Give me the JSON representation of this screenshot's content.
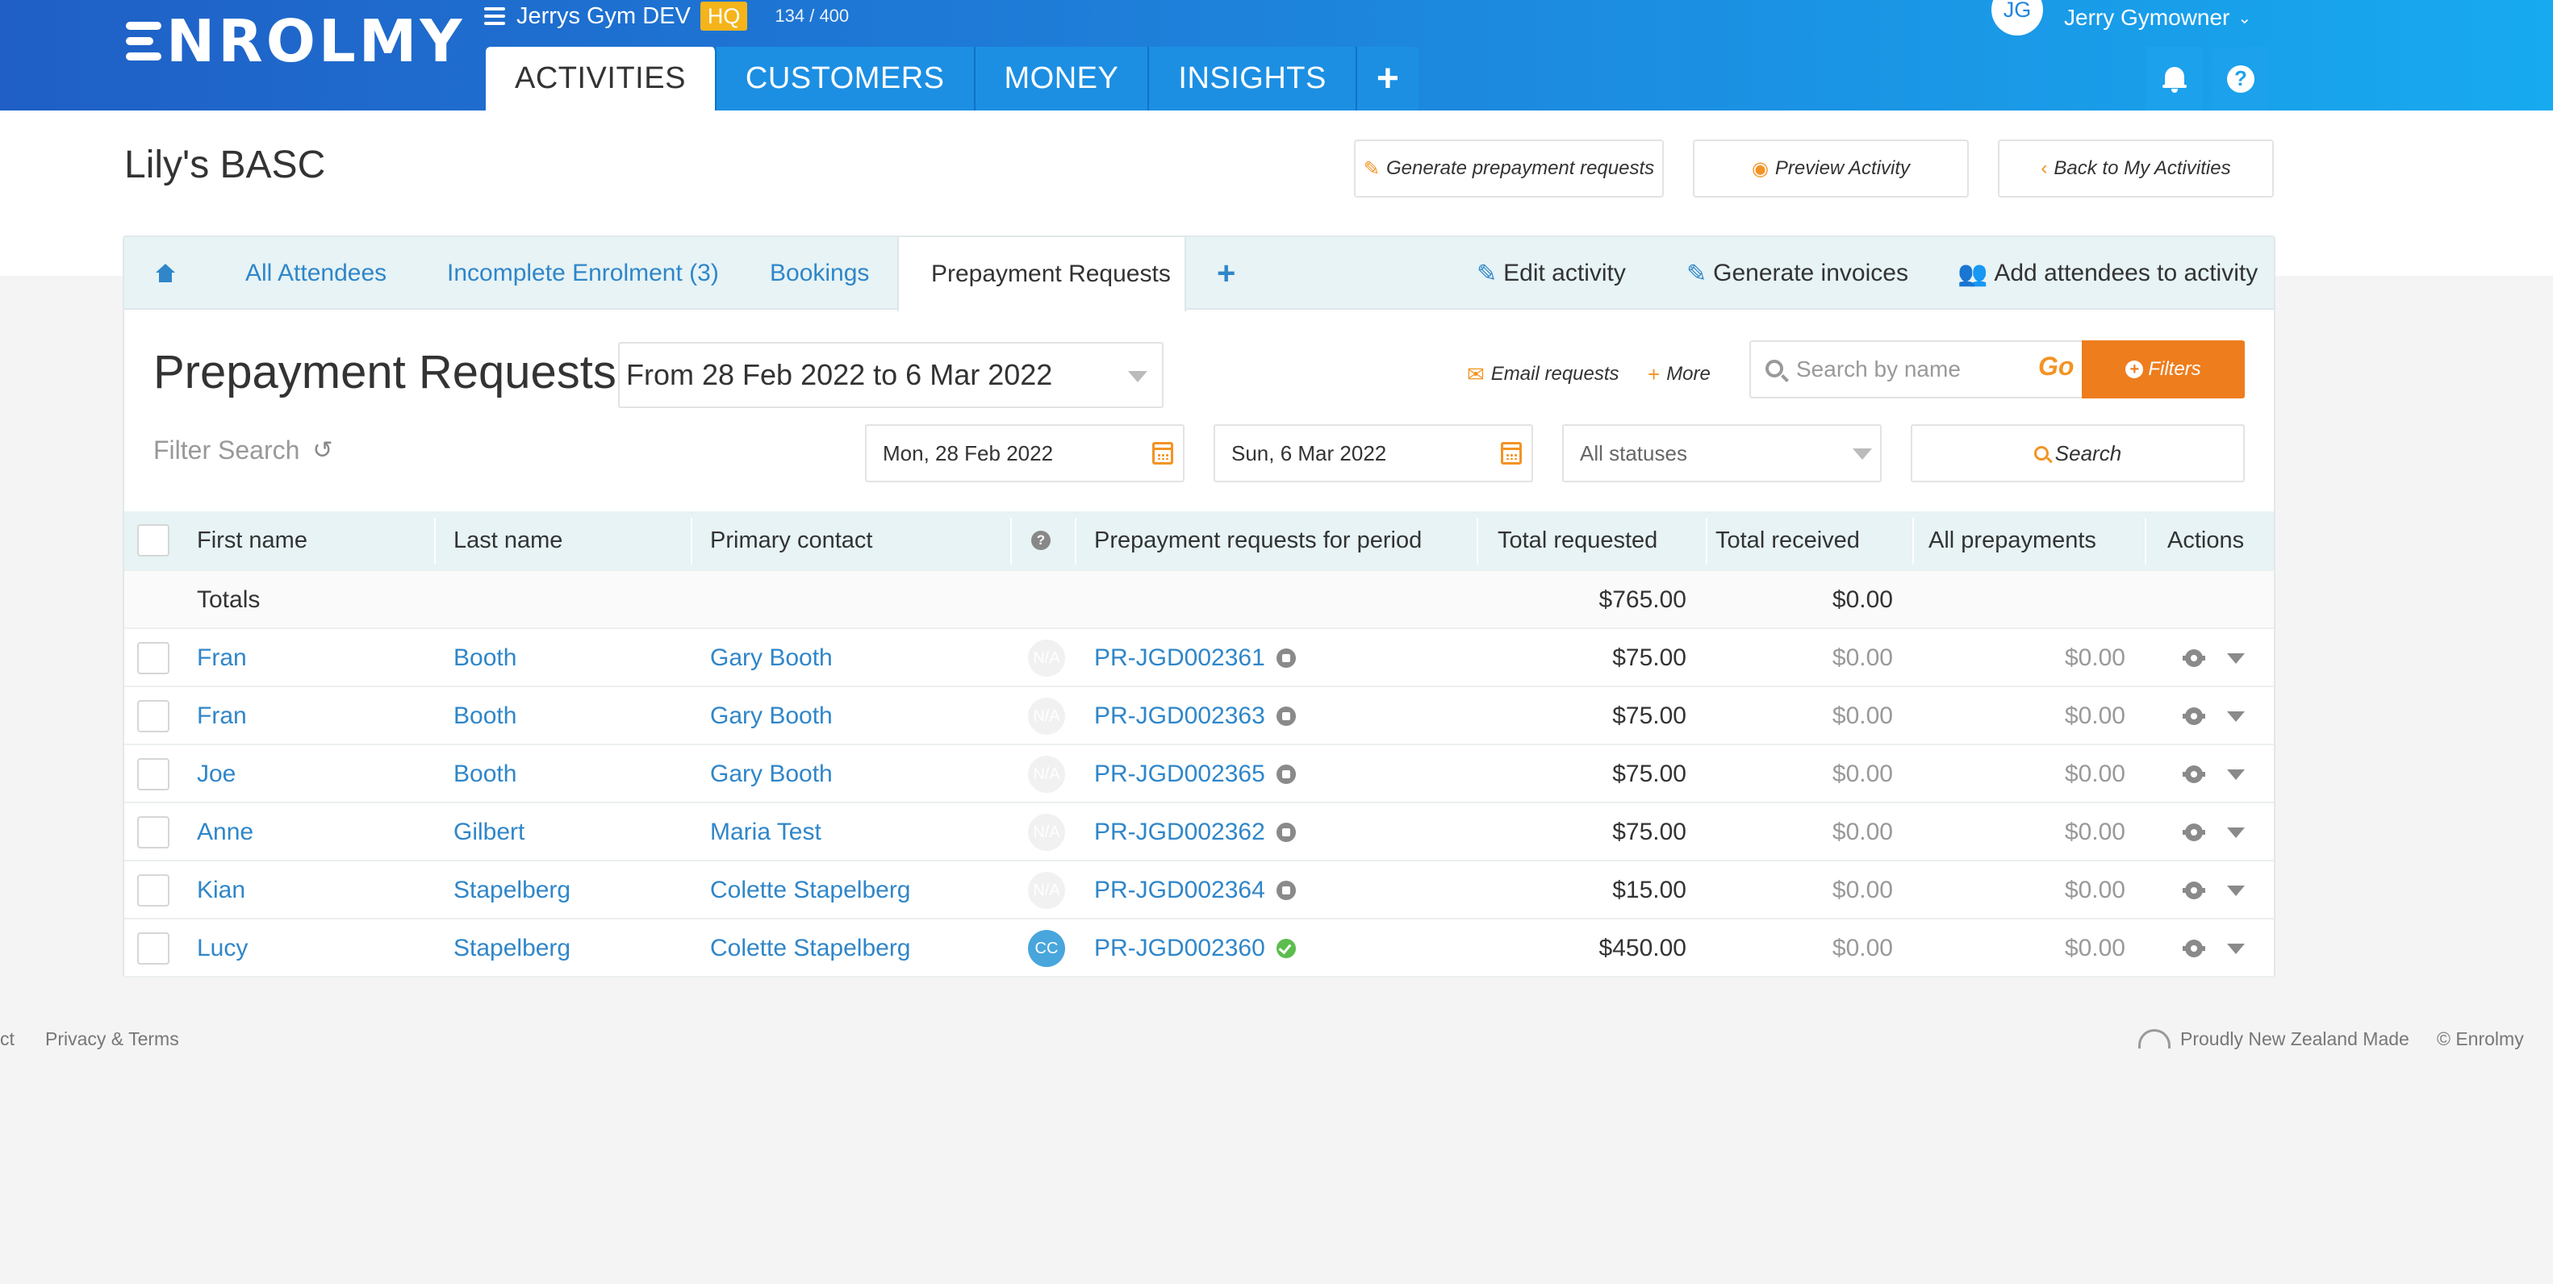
{
  "brand": {
    "logo_text": "NROLMY"
  },
  "org": {
    "name": "Jerrys Gym DEV",
    "badge": "HQ",
    "usage": "134 / 400"
  },
  "main_tabs": [
    {
      "label": "ACTIVITIES"
    },
    {
      "label": "CUSTOMERS"
    },
    {
      "label": "MONEY"
    },
    {
      "label": "INSIGHTS"
    }
  ],
  "user": {
    "initials": "JG",
    "name": "Jerry Gymowner"
  },
  "page": {
    "title": "Lily's BASC",
    "buttons": {
      "generate_prepayment": "Generate prepayment requests",
      "preview": "Preview Activity",
      "back": "Back to My Activities"
    }
  },
  "subtabs": {
    "all_attendees": "All Attendees",
    "incomplete": "Incomplete Enrolment (3)",
    "bookings": "Bookings",
    "prepayment": "Prepayment Requests",
    "edit_activity": "Edit activity",
    "generate_invoices": "Generate invoices",
    "add_attendees": "Add attendees to activity"
  },
  "section": {
    "title": "Prepayment Requests",
    "period": "From 28 Feb 2022 to 6 Mar 2022",
    "email_requests": "Email requests",
    "more": "More",
    "search_placeholder": "Search by name",
    "go": "Go",
    "filters": "Filters",
    "filter_search": "Filter Search",
    "date_from": "Mon, 28 Feb 2022",
    "date_to": "Sun, 6 Mar 2022",
    "status": "All statuses",
    "search": "Search"
  },
  "table": {
    "columns": {
      "first_name": "First name",
      "last_name": "Last name",
      "primary_contact": "Primary contact",
      "requests": "Prepayment requests for period",
      "total_requested": "Total requested",
      "total_received": "Total received",
      "all_prepayments": "All prepayments",
      "actions": "Actions"
    },
    "totals": {
      "label": "Totals",
      "requested": "$765.00",
      "received": "$0.00"
    },
    "rows": [
      {
        "first": "Fran",
        "last": "Booth",
        "contact": "Gary Booth",
        "avatar": "N/A",
        "ref": "PR-JGD002361",
        "status": "pending",
        "requested": "$75.00",
        "received": "$0.00",
        "all": "$0.00"
      },
      {
        "first": "Fran",
        "last": "Booth",
        "contact": "Gary Booth",
        "avatar": "N/A",
        "ref": "PR-JGD002363",
        "status": "pending",
        "requested": "$75.00",
        "received": "$0.00",
        "all": "$0.00"
      },
      {
        "first": "Joe",
        "last": "Booth",
        "contact": "Gary Booth",
        "avatar": "N/A",
        "ref": "PR-JGD002365",
        "status": "pending",
        "requested": "$75.00",
        "received": "$0.00",
        "all": "$0.00"
      },
      {
        "first": "Anne",
        "last": "Gilbert",
        "contact": "Maria Test",
        "avatar": "N/A",
        "ref": "PR-JGD002362",
        "status": "pending",
        "requested": "$75.00",
        "received": "$0.00",
        "all": "$0.00"
      },
      {
        "first": "Kian",
        "last": "Stapelberg",
        "contact": "Colette Stapelberg",
        "avatar": "N/A",
        "ref": "PR-JGD002364",
        "status": "pending",
        "requested": "$15.00",
        "received": "$0.00",
        "all": "$0.00"
      },
      {
        "first": "Lucy",
        "last": "Stapelberg",
        "contact": "Colette Stapelberg",
        "avatar": "CC",
        "ref": "PR-JGD002360",
        "status": "sent",
        "requested": "$450.00",
        "received": "$0.00",
        "all": "$0.00"
      }
    ]
  },
  "footer": {
    "contact_fragment": "ct",
    "privacy": "Privacy & Terms",
    "nz": "Proudly New Zealand Made",
    "copyright": "© Enrolmy"
  }
}
